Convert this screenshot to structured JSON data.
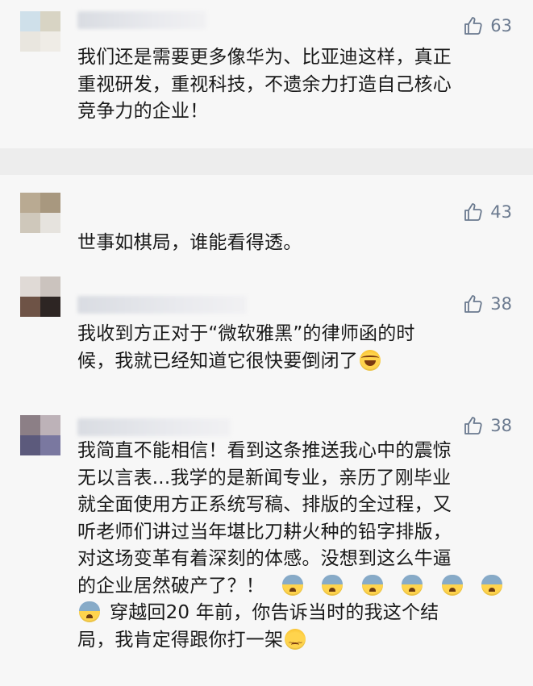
{
  "comments": [
    {
      "likes": "63",
      "lines": [
        "我们还是需要更多像华为、比亚迪这样，真正",
        "重视研发，重视科技，不遗余力打造自己核心",
        "竞争力的企业！"
      ],
      "avatar_colors": [
        "#cfe0ea",
        "#d8d4c4",
        "#e9e6df",
        "#efece6"
      ]
    },
    {
      "likes": "43",
      "lines": [
        "世事如棋局，谁能看得透。"
      ],
      "avatar_colors": [
        "#b9aa92",
        "#a8987f",
        "#cfc8bb",
        "#e6e3de"
      ]
    },
    {
      "likes": "38",
      "lines": [
        "我收到方正对于“微软雅黑”的律师函的时",
        "候，我就已经知道它很快要倒闭了"
      ],
      "avatar_colors": [
        "#e0dad6",
        "#cbc3be",
        "#6e5346",
        "#2d2523"
      ]
    },
    {
      "likes": "38",
      "lines": [
        "我简直不能相信！看到这条推送我心中的震惊",
        "无以言表...我学的是新闻专业，亲历了刚毕业",
        "就全面使用方正系统写稿、排版的全过程，又",
        "听老师们讲过当年堪比刀耕火种的铅字排版，",
        "对这场变革有着深刻的体感。没想到这么牛逼",
        "的企业居然破产了？！",
        "穿越回20 年前，你告诉当时的我这个结",
        "局，我肯定得跟你打一架"
      ],
      "avatar_colors": [
        "#8c7f86",
        "#bdb2b8",
        "#5c5a7c",
        "#7a78a0"
      ]
    }
  ],
  "emoji_names": [
    "laughing-tears-emoji",
    "fearful-face-emoji",
    "weary-face-emoji"
  ],
  "colors": {
    "text": "#191919",
    "like": "#6b7a8f",
    "card": "#f7f7f7",
    "gap": "#ededed"
  }
}
